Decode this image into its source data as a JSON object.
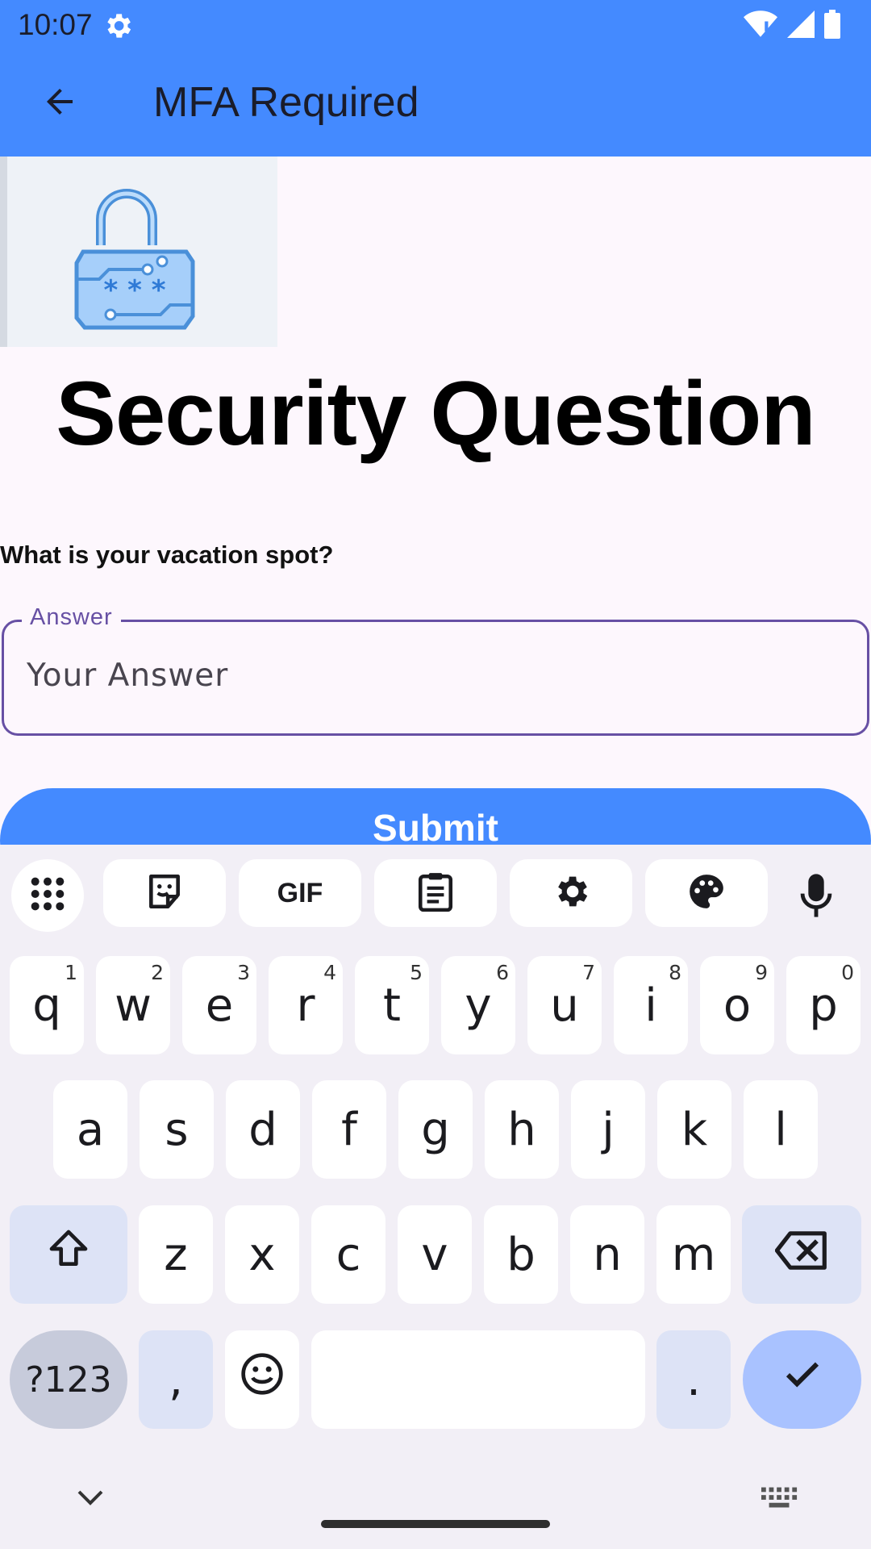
{
  "status_bar": {
    "time": "10:07"
  },
  "app_bar": {
    "title": "MFA Required"
  },
  "content": {
    "heading": "Security Question",
    "question": "What is your vacation spot?",
    "answer_label": "Answer",
    "answer_placeholder": "Your Answer",
    "answer_value": "",
    "submit_label": "Submit"
  },
  "keyboard": {
    "toolbar": {
      "gif_label": "GIF"
    },
    "row1": [
      {
        "key": "q",
        "hint": "1"
      },
      {
        "key": "w",
        "hint": "2"
      },
      {
        "key": "e",
        "hint": "3"
      },
      {
        "key": "r",
        "hint": "4"
      },
      {
        "key": "t",
        "hint": "5"
      },
      {
        "key": "y",
        "hint": "6"
      },
      {
        "key": "u",
        "hint": "7"
      },
      {
        "key": "i",
        "hint": "8"
      },
      {
        "key": "o",
        "hint": "9"
      },
      {
        "key": "p",
        "hint": "0"
      }
    ],
    "row2": [
      "a",
      "s",
      "d",
      "f",
      "g",
      "h",
      "j",
      "k",
      "l"
    ],
    "row3": [
      "z",
      "x",
      "c",
      "v",
      "b",
      "n",
      "m"
    ],
    "symbols_label": "?123",
    "comma": ",",
    "period": "."
  },
  "colors": {
    "app_bar": "#448aff",
    "background": "#fdf7fd",
    "field_outline": "#6750a4",
    "submit": "#448aff",
    "keyboard_bg": "#f2eff6",
    "done_key": "#a9c2ff"
  },
  "icons": {
    "status": [
      "gear-icon",
      "wifi-icon",
      "signal-icon",
      "battery-icon"
    ],
    "app_bar": [
      "back-arrow-icon"
    ],
    "logo": "padlock-icon",
    "keyboard_toolbar": [
      "apps-grid-icon",
      "sticker-icon",
      "gif-icon",
      "clipboard-icon",
      "settings-icon",
      "palette-icon",
      "mic-icon"
    ],
    "keyboard": [
      "shift-icon",
      "backspace-icon",
      "emoji-icon",
      "check-icon"
    ],
    "nav": [
      "chevron-down-icon",
      "keyboard-icon"
    ]
  }
}
